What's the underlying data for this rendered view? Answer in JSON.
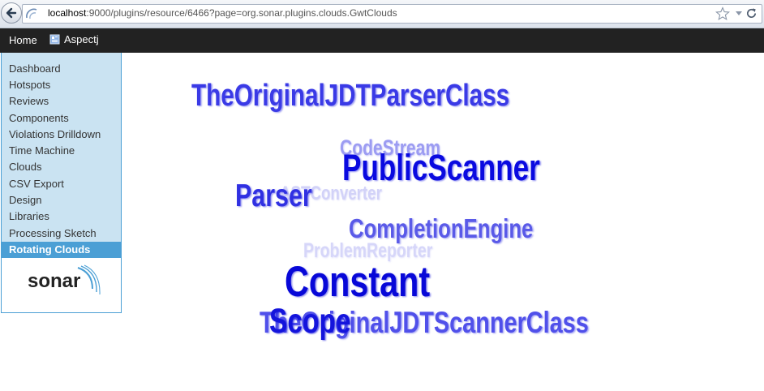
{
  "browser": {
    "url_host": "localhost",
    "url_rest": ":9000/plugins/resource/6466?page=org.sonar.plugins.clouds.GwtClouds"
  },
  "nav": {
    "home_label": "Home",
    "project_label": "Aspectj"
  },
  "sidebar": {
    "items": [
      {
        "label": "Dashboard"
      },
      {
        "label": "Hotspots"
      },
      {
        "label": "Reviews"
      },
      {
        "label": "Components"
      },
      {
        "label": "Violations Drilldown"
      },
      {
        "label": "Time Machine"
      },
      {
        "label": "Clouds"
      },
      {
        "label": "CSV Export"
      },
      {
        "label": "Design"
      },
      {
        "label": "Libraries"
      },
      {
        "label": "Processing Sketch"
      },
      {
        "label": "Rotating Clouds"
      }
    ],
    "selected_index": 11,
    "logo_text": "sonar"
  },
  "cloud": {
    "words": [
      {
        "text": "TheOriginalJDTParserClass",
        "color": "#3a3ae6"
      },
      {
        "text": "CodeStream",
        "color": "#9c9cf2"
      },
      {
        "text": "PublicScanner",
        "color": "#0a0ae0"
      },
      {
        "text": "ASTConverter",
        "color": "#d2d2f8"
      },
      {
        "text": "Parser",
        "color": "#3030e2"
      },
      {
        "text": "CompletionEngine",
        "color": "#5a5ae8"
      },
      {
        "text": "ProblemReporter",
        "color": "#d6d6f9"
      },
      {
        "text": "Constant",
        "color": "#0808d8"
      },
      {
        "text": "TheOriginalJDTScannerClass",
        "color": "#5050ea"
      },
      {
        "text": "Scope",
        "color": "#1414dc"
      }
    ]
  },
  "colors": {
    "nav_bg": "#222222",
    "sidebar_bg": "#cae3f2",
    "sidebar_border": "#4b9fd5",
    "selected_bg": "#4b9fd5"
  }
}
